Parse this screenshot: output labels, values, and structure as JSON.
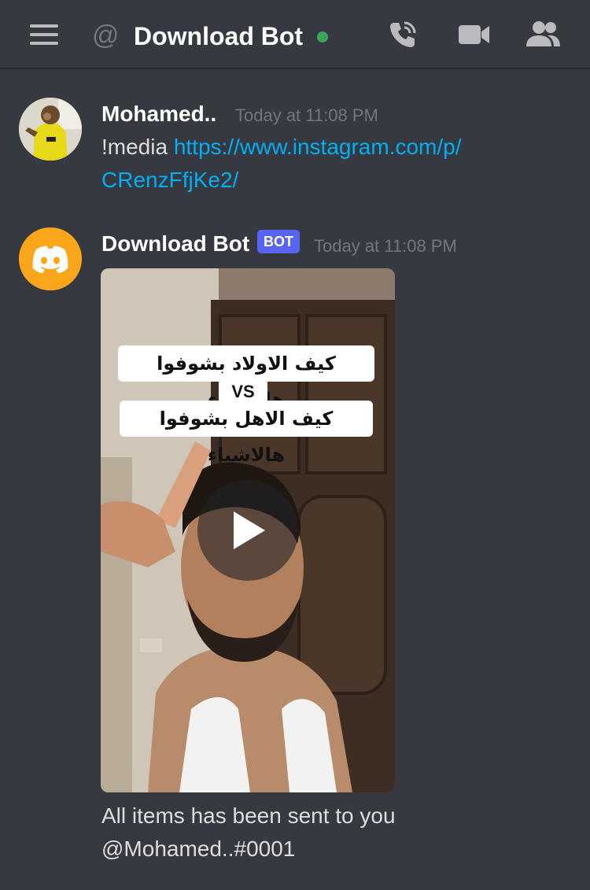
{
  "header": {
    "channel_title": "Download Bot",
    "at_symbol": "@",
    "icons": [
      "menu-icon",
      "at-icon",
      "phone-call-icon",
      "video-camera-icon",
      "members-icon"
    ],
    "online_color": "#3ba55c"
  },
  "messages": [
    {
      "author": "Mohamed..",
      "timestamp": "Today at 11:08 PM",
      "command": "!media",
      "link_line1": "https://www.instagram.com/p/",
      "link_line2": "CRenzFfjKe2/"
    },
    {
      "author": "Download Bot",
      "badge": "BOT",
      "timestamp": "Today at 11:08 PM",
      "video": {
        "caption_line1": "كيف الاولاد بشوفوا هالاشياء",
        "caption_vs": "VS",
        "caption_line2": "كيف الاهل بشوفوا هالاشياء"
      },
      "text_line1": "All items has been sent to you",
      "text_line2": "@Mohamed..#0001"
    }
  ],
  "colors": {
    "background": "#36393f",
    "link": "#00aff4",
    "bot_badge": "#5865f2",
    "bot_avatar": "#faa61a"
  }
}
